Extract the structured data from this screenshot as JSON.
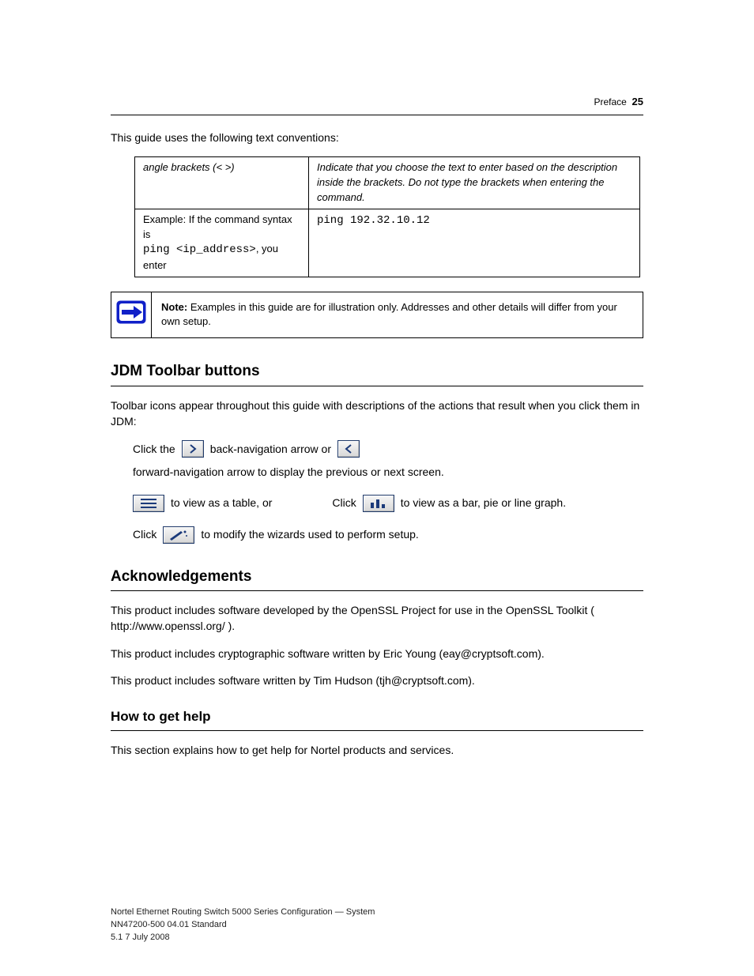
{
  "header": {
    "prefix": "Preface",
    "page_number": "25"
  },
  "intro_para": "This guide uses the following text conventions:",
  "conv_table": {
    "r1c1": "angle brackets (< >)",
    "r1c2": "Indicate that you choose the text to enter based on the description inside the brackets. Do not type the brackets when entering the command.",
    "r2c1_pre": "Example: If the command syntax is",
    "r2c1_cmd": "ping <ip_address>",
    "r2c1_post": ", you enter",
    "r2c2_cmd": "ping 192.32.10.12"
  },
  "note": {
    "label": "Note:",
    "text": "Examples in this guide are for illustration only. Addresses and other details will differ from your own setup."
  },
  "sections": {
    "toolbar_title": "JDM Toolbar buttons",
    "toolbar_intro": "Toolbar icons appear throughout this guide with descriptions of the actions that result when you click them in JDM:",
    "tb_row1_a": "Click the",
    "tb_row1_b": "back-navigation arrow or",
    "tb_row1_c": "forward-navigation arrow to display the previous or next screen.",
    "tb_row2_a": "to view as a table, or",
    "tb_row2_b": "Click",
    "tb_row2_c": "to view as a bar, pie or line graph.",
    "tb_row3_a": "Click",
    "tb_row3_b": "to modify the wizards used to perform setup.",
    "ack_title": "Acknowledgements",
    "ack_para": "This product includes software developed by the OpenSSL Project for use in the OpenSSL Toolkit ( http://www.openssl.org/ ).",
    "ack_para2": "This product includes cryptographic software written by Eric Young (eay@cryptsoft.com).",
    "ack_para3": "This product includes software written by Tim Hudson (tjh@cryptsoft.com).",
    "find_title": "How to get help",
    "find_para": "This section explains how to get help for Nortel products and services."
  },
  "footer": "Nortel Ethernet Routing Switch 5000 Series Configuration — System\nNN47200-500 04.01 Standard\n5.1 7 July 2008"
}
